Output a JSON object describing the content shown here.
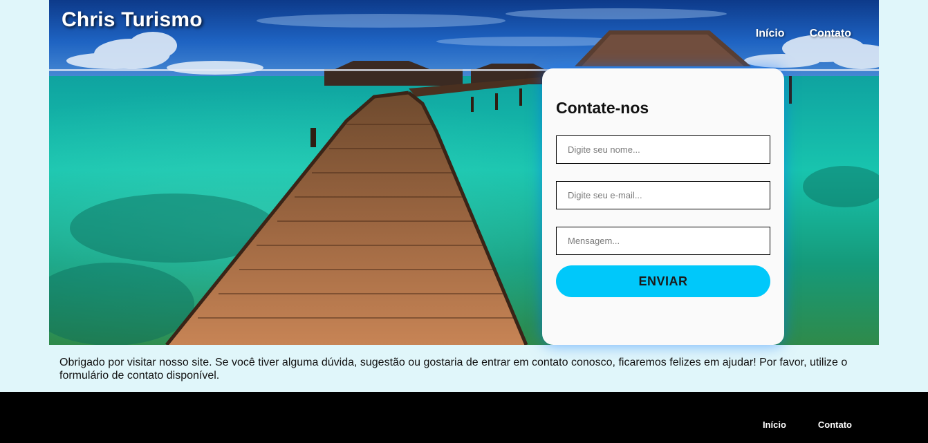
{
  "header": {
    "brand": "Chris Turismo",
    "nav": [
      "Início",
      "Contato"
    ]
  },
  "contact_form": {
    "title": "Contate-nos",
    "name_placeholder": "Digite seu nome...",
    "email_placeholder": "Digite seu e-mail...",
    "message_placeholder": "Mensagem...",
    "submit_label": "ENVIAR"
  },
  "intro_text": "Obrigado por visitar nosso site. Se você tiver alguma dúvida, sugestão ou gostaria de entrar em contato conosco, ficaremos felizes em ajudar! Por favor, utilize o formulário de contato disponível.",
  "footer": {
    "nav": [
      "Início",
      "Contato"
    ]
  },
  "colors": {
    "page_background": "#e0f6fa",
    "accent_button": "#00c8fa",
    "footer_background": "#000000",
    "card_glow": "#006eff"
  }
}
